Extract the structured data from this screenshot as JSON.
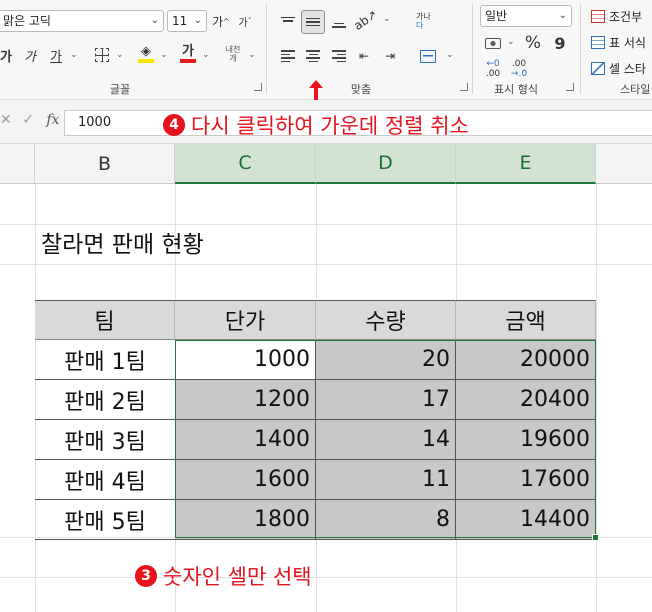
{
  "ribbon": {
    "font_name": "맑은 고딕",
    "font_size": "11",
    "grow_font": "가",
    "shrink_font": "가",
    "bold": "가",
    "italic": "가",
    "underline": "가",
    "font_color_glyph": "가",
    "phonetic_line1": "내천",
    "phonetic_line2": "개",
    "wrap_text_line1": "가나",
    "wrap_text_line2": "다",
    "groups": {
      "font": "글꼴",
      "alignment": "맞춤",
      "number": "표시 형식",
      "styles": "스타일"
    },
    "number_format": "일반",
    "percent": "%",
    "comma": "9",
    "increase_decimal_top": "←0",
    "increase_decimal_bottom": ".00",
    "decrease_decimal_top": ".00",
    "decrease_decimal_bottom": "→.0",
    "conditional_formatting": "조건부",
    "format_as_table": "표 서식",
    "cell_styles": "셀 스타",
    "colors": {
      "fill": "#f5e500",
      "font": "#e31b23",
      "accent_green": "#1e7a3c",
      "annotation": "#e8121e"
    }
  },
  "formula_bar": {
    "value": "1000"
  },
  "annotations": {
    "step4_number": "4",
    "step4_text": "다시 클릭하여 가운데 정렬 취소",
    "step3_number": "3",
    "step3_text": "숫자인 셀만 선택"
  },
  "sheet": {
    "columns": [
      "B",
      "C",
      "D",
      "E"
    ],
    "title": "찰라면 판매 현황",
    "table": {
      "headers": [
        "팀",
        "단가",
        "수량",
        "금액"
      ],
      "rows": [
        {
          "team": "판매 1팀",
          "price": "1000",
          "qty": "20",
          "amount": "20000"
        },
        {
          "team": "판매 2팀",
          "price": "1200",
          "qty": "17",
          "amount": "20400"
        },
        {
          "team": "판매 3팀",
          "price": "1400",
          "qty": "14",
          "amount": "19600"
        },
        {
          "team": "판매 4팀",
          "price": "1600",
          "qty": "11",
          "amount": "17600"
        },
        {
          "team": "판매 5팀",
          "price": "1800",
          "qty": "8",
          "amount": "14400"
        }
      ]
    }
  }
}
